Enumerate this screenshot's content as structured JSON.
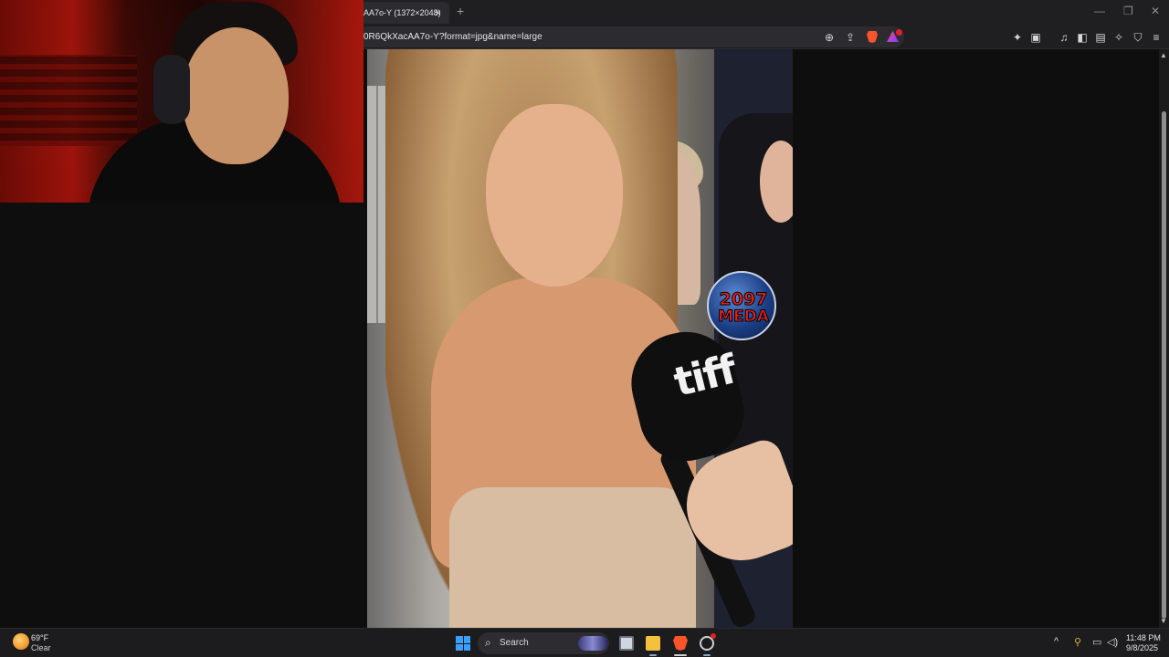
{
  "browser": {
    "tab_title": "AA7o-Y (1372×2048)",
    "tab_close": "×",
    "new_tab": "+",
    "window_minimize": "—",
    "window_restore": "❐",
    "window_close": "✕",
    "url": "0R6QkXacAA7o-Y?format=jpg&name=large",
    "icons": [
      "zoom-icon",
      "share-icon",
      "brave-shields-icon",
      "brave-rewards-icon",
      "extensions-icon",
      "translate-icon",
      "media-icon",
      "sidebar-icon",
      "wallet-icon",
      "leo-ai-icon",
      "vpn-icon",
      "menu-icon"
    ],
    "rewards_badge_color": "#e2202c"
  },
  "image": {
    "mic_label": "tiff",
    "logo_line1": "2097",
    "logo_line2": "MEDA"
  },
  "taskbar": {
    "weather_temp": "69°F",
    "weather_condition": "Clear",
    "search_label": "Search",
    "search_icon": "⌕",
    "clock_time": "11:48 PM",
    "clock_date": "9/8/2025",
    "tray_chevron": "^",
    "accent_color": "#3aa0ff"
  }
}
